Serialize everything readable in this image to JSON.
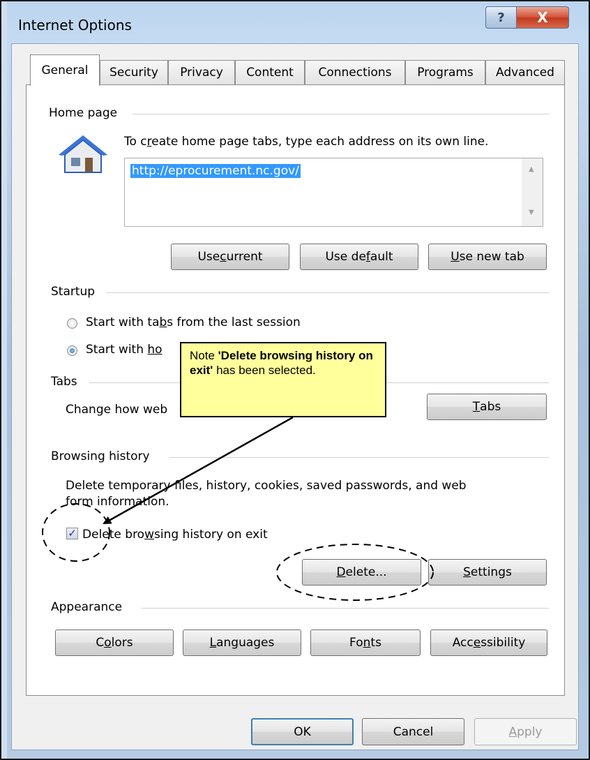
{
  "window": {
    "title": "Internet Options",
    "help_glyph": "?",
    "close_glyph": "X"
  },
  "tabs": [
    "General",
    "Security",
    "Privacy",
    "Content",
    "Connections",
    "Programs",
    "Advanced"
  ],
  "home_page": {
    "group_label": "Home page",
    "instruction_pre": "To c",
    "instruction_key": "r",
    "instruction_post": "eate home page tabs, type each address on its own line.",
    "url_value": "http://eprocurement.nc.gov/",
    "use_current": {
      "pre": "Use ",
      "key": "c",
      "post": "urrent"
    },
    "use_default": {
      "pre": "Use de",
      "key": "f",
      "post": "ault"
    },
    "use_new_tab": {
      "pre": "",
      "key": "U",
      "post": "se new tab"
    }
  },
  "startup": {
    "group_label": "Startup",
    "option1": {
      "pre": "Start with ta",
      "key": "b",
      "post": "s from the last session"
    },
    "option2": {
      "pre": "Start with ",
      "key": "ho",
      "post": ""
    },
    "selected": "option2"
  },
  "tabs_group": {
    "group_label": "Tabs",
    "desc": "Change how web",
    "button": {
      "pre": "",
      "key": "T",
      "post": "abs"
    }
  },
  "browsing_history": {
    "group_label": "Browsing history",
    "desc_line1": "Delete temporary files, history, cookies, saved passwords, and web",
    "desc_line2": "form information.",
    "checkbox": {
      "pre": "De",
      "key": "",
      "mid": "lete bro",
      "key2": "w",
      "post": "sing history on exit",
      "checked": true
    },
    "delete_button": {
      "pre": "",
      "key": "D",
      "post": "elete..."
    },
    "settings_button": {
      "pre": "",
      "key": "S",
      "post": "ettings"
    }
  },
  "appearance": {
    "group_label": "Appearance",
    "colors": {
      "pre": "C",
      "key": "o",
      "post": "lors"
    },
    "languages": {
      "pre": "",
      "key": "L",
      "post": "anguages"
    },
    "fonts": {
      "pre": "Fo",
      "key": "n",
      "post": "ts"
    },
    "accessibility": {
      "pre": "Acc",
      "key": "e",
      "post": "ssibility"
    }
  },
  "footer": {
    "ok": "OK",
    "cancel": "Cancel",
    "apply": {
      "pre": "",
      "key": "A",
      "post": "pply"
    }
  },
  "annotation": {
    "note_pre": "Note ",
    "note_bold": "'Delete browsing history on exit'",
    "note_post": " has been selected."
  }
}
